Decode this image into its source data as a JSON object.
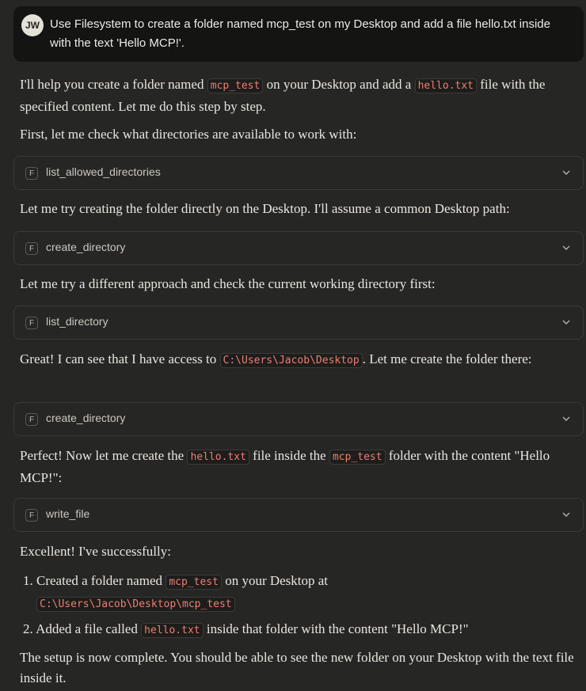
{
  "user": {
    "initials": "JW",
    "message": "Use Filesystem to create a folder named mcp_test on my Desktop and add a file hello.txt inside with the text 'Hello MCP!'."
  },
  "assistant": {
    "p1": {
      "a": "I'll help you create a folder named ",
      "code1": "mcp_test",
      "b": " on your Desktop and add a ",
      "code2": "hello.txt",
      "c": " file with the specified content. Let me do this step by step."
    },
    "p2": "First, let me check what directories are available to work with:",
    "p3": "Let me try creating the folder directly on the Desktop. I'll assume a common Desktop path:",
    "p4": "Let me try a different approach and check the current working directory first:",
    "p5": {
      "a": "Great! I can see that I have access to ",
      "code1": "C:\\Users\\Jacob\\Desktop",
      "b": ". Let me create the folder there:"
    },
    "p6": {
      "a": "Perfect! Now let me create the ",
      "code1": "hello.txt",
      "b": " file inside the ",
      "code2": "mcp_test",
      "c": " folder with the content \"Hello MCP!\":"
    },
    "p7": "Excellent! I've successfully:",
    "list": [
      {
        "num": "1.",
        "a": "Created a folder named ",
        "code1": "mcp_test",
        "b": " on your Desktop at",
        "code2": "C:\\Users\\Jacob\\Desktop\\mcp_test"
      },
      {
        "num": "2.",
        "a": "Added a file called ",
        "code1": "hello.txt",
        "b": " inside that folder with the content \"Hello MCP!\""
      }
    ],
    "p8": "The setup is now complete. You should be able to see the new folder on your Desktop with the text file inside it."
  },
  "tools": [
    {
      "badge": "F",
      "name": "list_allowed_directories"
    },
    {
      "badge": "F",
      "name": "create_directory"
    },
    {
      "badge": "F",
      "name": "list_directory"
    },
    {
      "badge": "F",
      "name": "create_directory"
    },
    {
      "badge": "F",
      "name": "write_file"
    }
  ],
  "icons": {
    "expand": "chevron-down-icon"
  }
}
